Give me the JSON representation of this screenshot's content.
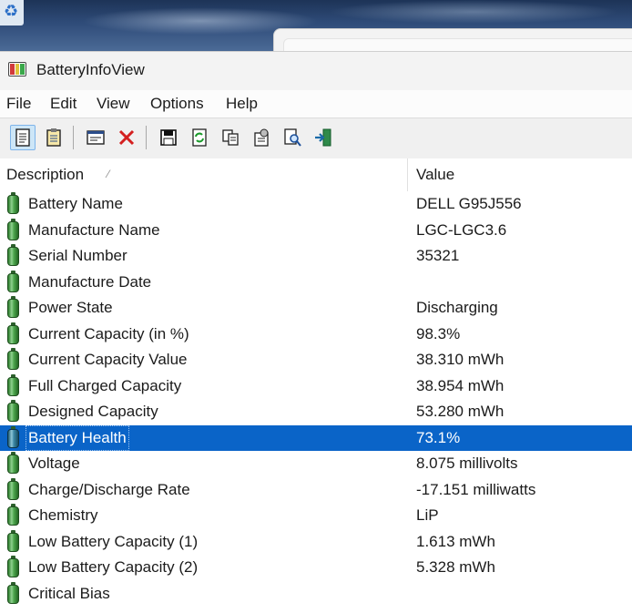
{
  "window": {
    "title": "BatteryInfoView"
  },
  "menu": [
    "File",
    "Edit",
    "View",
    "Options",
    "Help"
  ],
  "toolbar": {
    "icons": [
      "simple-mode-icon",
      "log-mode-icon",
      "properties-icon",
      "delete-icon",
      "save-icon",
      "refresh-icon",
      "copy-icon",
      "options-icon",
      "find-icon",
      "exit-icon"
    ]
  },
  "list": {
    "columns": {
      "description": "Description",
      "value": "Value"
    },
    "sort_glyph": "⁄",
    "selected_index": 9,
    "rows": [
      {
        "description": "Battery Name",
        "value": "DELL G95J556"
      },
      {
        "description": "Manufacture Name",
        "value": "LGC-LGC3.6"
      },
      {
        "description": "Serial Number",
        "value": "35321"
      },
      {
        "description": "Manufacture Date",
        "value": ""
      },
      {
        "description": "Power State",
        "value": "Discharging"
      },
      {
        "description": "Current Capacity (in %)",
        "value": "98.3%"
      },
      {
        "description": "Current Capacity Value",
        "value": "38.310 mWh"
      },
      {
        "description": "Full Charged Capacity",
        "value": "38.954 mWh"
      },
      {
        "description": "Designed Capacity",
        "value": "53.280 mWh"
      },
      {
        "description": "Battery Health",
        "value": "73.1%"
      },
      {
        "description": "Voltage",
        "value": "8.075 millivolts"
      },
      {
        "description": "Charge/Discharge Rate",
        "value": "-17.151 milliwatts"
      },
      {
        "description": "Chemistry",
        "value": "LiP"
      },
      {
        "description": "Low Battery Capacity (1)",
        "value": "1.613 mWh"
      },
      {
        "description": "Low Battery Capacity (2)",
        "value": "5.328 mWh"
      },
      {
        "description": "Critical Bias",
        "value": ""
      }
    ]
  },
  "colors": {
    "selection": "#0a64c8",
    "battery_green": "#4fa84f"
  }
}
